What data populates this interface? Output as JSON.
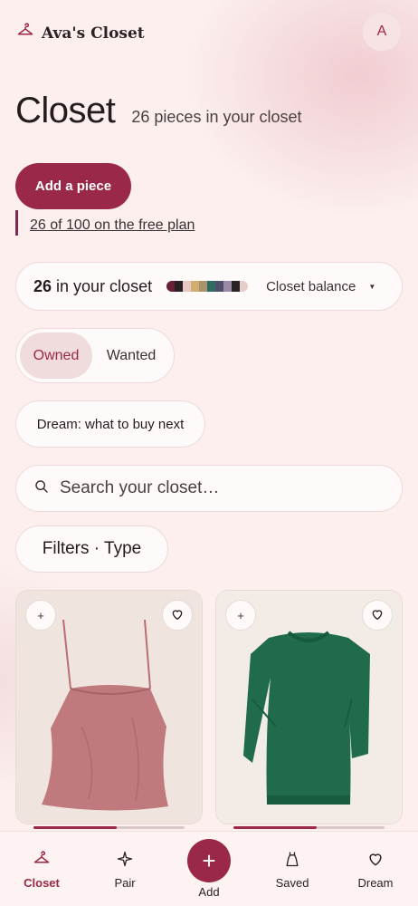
{
  "brand": {
    "name": "Ava's Closet",
    "icon": "hanger-icon"
  },
  "avatar": {
    "initial": "A"
  },
  "header": {
    "title": "Closet",
    "subtitle": "26 pieces in your closet"
  },
  "actions": {
    "add_label": "Add a piece",
    "plan_text": "26 of 100 on the free plan"
  },
  "balance": {
    "count": "26",
    "text": "in your closet",
    "select_label": "Closet balance",
    "swatch_colors": [
      "#6b1f34",
      "#2a1f22",
      "#e8c7c4",
      "#cfae6f",
      "#a8956e",
      "#2f6b62",
      "#4d4f6b",
      "#9a8aa6",
      "#2a2224",
      "#e6cfca"
    ]
  },
  "segment": {
    "owned": "Owned",
    "wanted": "Wanted",
    "selected": "Owned"
  },
  "dream": {
    "label": "Dream: what to buy next"
  },
  "search": {
    "placeholder": "Search your closet…"
  },
  "filters": {
    "label": "Filters · Type"
  },
  "items": [
    {
      "name": "pink camisole",
      "add": "+",
      "fav_icon": "heart-icon",
      "wear_fraction": 0.55
    },
    {
      "name": "green sweater",
      "add": "+",
      "fav_icon": "heart-icon",
      "wear_fraction": 0.55
    }
  ],
  "nav": {
    "closet": "Closet",
    "pair": "Pair",
    "add": "Add",
    "add_symbol": "+",
    "saved": "Saved",
    "dream": "Dream",
    "active": "Closet"
  },
  "colors": {
    "accent": "#9a2849",
    "background": "#fcefee"
  }
}
